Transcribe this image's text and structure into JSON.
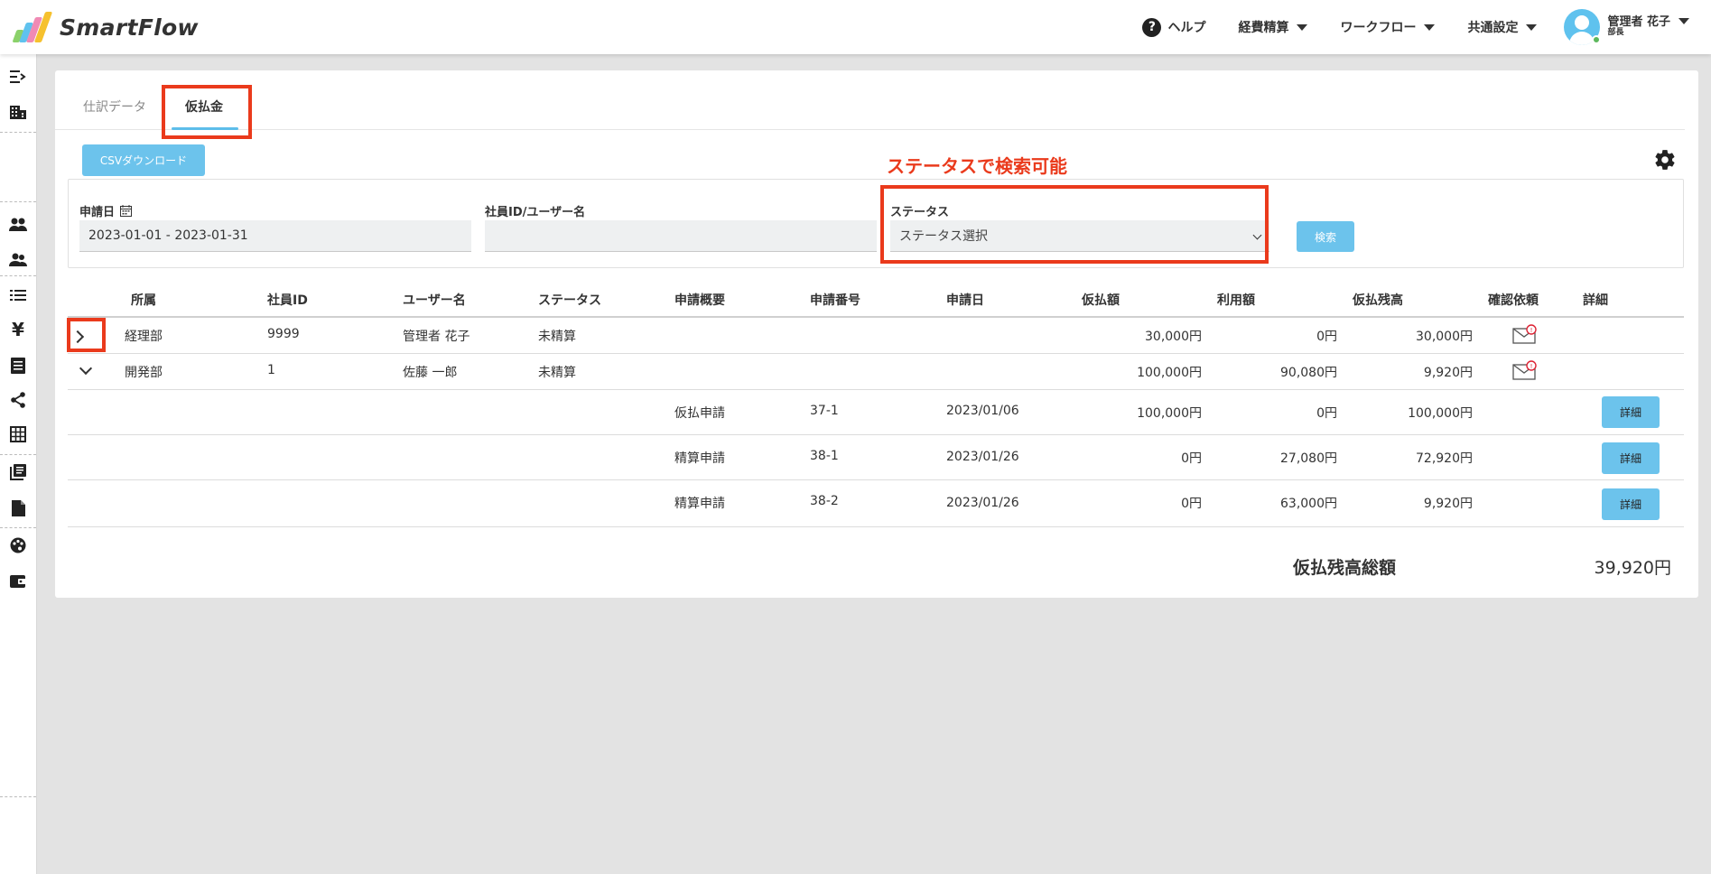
{
  "app": {
    "logo_text": "SmartFlow"
  },
  "header": {
    "help": "ヘルプ",
    "menu_expense": "経費精算",
    "menu_workflow": "ワークフロー",
    "menu_common": "共通設定",
    "user_name": "管理者 花子",
    "user_role": "部長"
  },
  "sidebar": {
    "icons": [
      "sidebar-toggle-icon",
      "building-icon",
      "users-icon",
      "team-icon",
      "list-icon",
      "yen-icon",
      "document-list-icon",
      "share-icon",
      "grid-icon",
      "library-icon",
      "file-icon",
      "palette-icon",
      "wallet-icon"
    ]
  },
  "tabs": {
    "journal": "仕訳データ",
    "advance": "仮払金"
  },
  "annotation": "ステータスで検索可能",
  "toolbar": {
    "csv_download": "CSVダウンロード"
  },
  "filters": {
    "date_label": "申請日",
    "date_value": "2023-01-01 - 2023-01-31",
    "user_label": "社員ID/ユーザー名",
    "user_value": "",
    "status_label": "ステータス",
    "status_value": "ステータス選択",
    "search": "検索"
  },
  "table": {
    "headers": {
      "department": "所属",
      "employee_id": "社員ID",
      "user_name": "ユーザー名",
      "status": "ステータス",
      "summary": "申請概要",
      "app_no": "申請番号",
      "app_date": "申請日",
      "advance": "仮払額",
      "used": "利用額",
      "balance": "仮払残高",
      "confirm": "確認依頼",
      "detail": "詳細"
    },
    "groups": [
      {
        "expanded": false,
        "department": "経理部",
        "employee_id": "9999",
        "user_name": "管理者 花子",
        "status": "未精算",
        "advance": "30,000円",
        "used": "0円",
        "balance": "30,000円"
      },
      {
        "expanded": true,
        "department": "開発部",
        "employee_id": "1",
        "user_name": "佐藤 一郎",
        "status": "未精算",
        "advance": "100,000円",
        "used": "90,080円",
        "balance": "9,920円"
      }
    ],
    "details": [
      {
        "summary": "仮払申請",
        "app_no": "37-1",
        "app_date": "2023/01/06",
        "advance": "100,000円",
        "used": "0円",
        "balance": "100,000円",
        "button": "詳細"
      },
      {
        "summary": "精算申請",
        "app_no": "38-1",
        "app_date": "2023/01/26",
        "advance": "0円",
        "used": "27,080円",
        "balance": "72,920円",
        "button": "詳細"
      },
      {
        "summary": "精算申請",
        "app_no": "38-2",
        "app_date": "2023/01/26",
        "advance": "0円",
        "used": "63,000円",
        "balance": "9,920円",
        "button": "詳細"
      }
    ]
  },
  "total": {
    "label": "仮払残高総額",
    "value": "39,920円"
  },
  "colors": {
    "accent": "#6cc3ec",
    "annotation_red": "#ea3a1c",
    "online": "#5cb85c"
  }
}
